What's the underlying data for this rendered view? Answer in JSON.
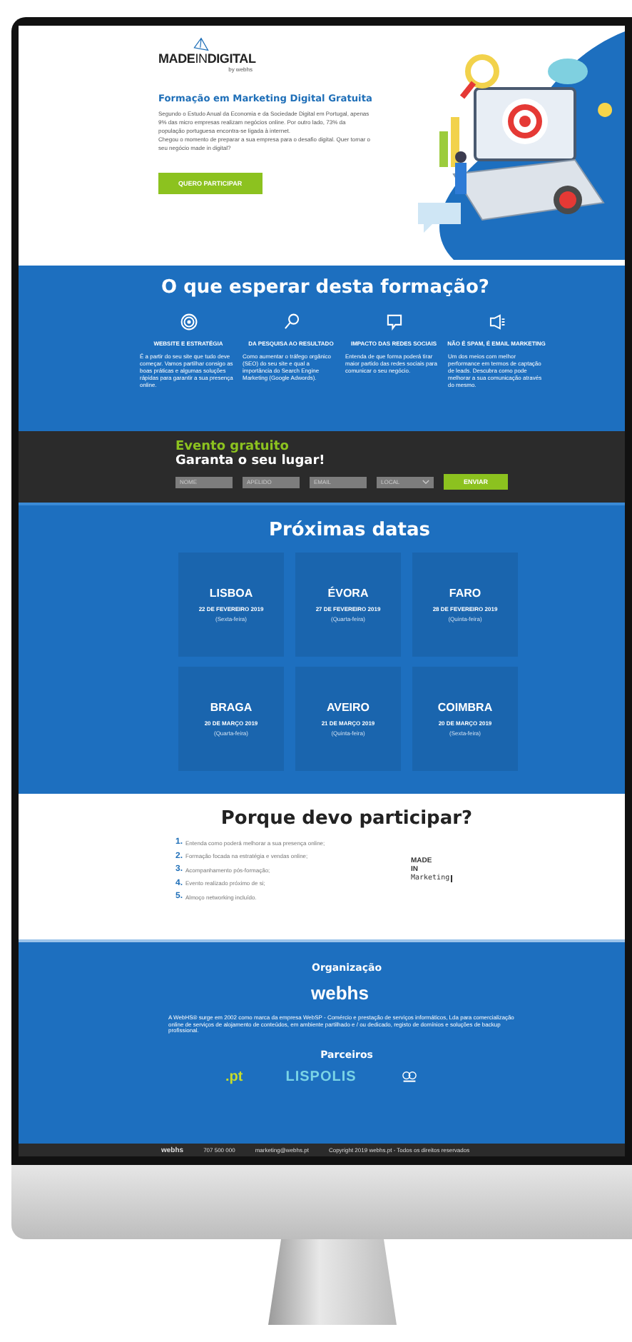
{
  "brand": {
    "made": "MADE",
    "in": "IN",
    "digital": "DIGITAL",
    "by": "by webhs"
  },
  "hero": {
    "title": "Formação em Marketing Digital Gratuita",
    "paragraphs": [
      "Segundo o Estudo Anual da Economia e da Sociedade Digital em Portugal, apenas 9% das micro empresas realizam negócios online. Por outro lado, 73% da população portuguesa encontra-se ligada à internet.",
      "Chegou o momento de preparar a sua empresa para o desafio digital. Quer tornar o seu negócio made in digital?"
    ],
    "button": "QUERO PARTICIPAR"
  },
  "features": {
    "title": "O que esperar desta formação?",
    "items": [
      {
        "title": "WEBSITE E ESTRATÉGIA",
        "text": "É a partir do seu site que tudo deve começar. Vamos partilhar consigo as boas práticas e algumas soluções rápidas para garantir a sua presença online."
      },
      {
        "title": "DA PESQUISA AO RESULTADO",
        "text": "Como aumentar o tráfego orgânico (SEO) do seu site e qual a importância do Search Engine Marketing (Google Adwords)."
      },
      {
        "title": "IMPACTO DAS REDES SOCIAIS",
        "text": "Entenda de que forma poderá tirar maior partido das redes sociais para comunicar o seu negócio."
      },
      {
        "title": "NÃO É SPAM, É EMAIL MARKETING",
        "text": "Um dos meios com melhor performance em termos de captação de leads. Descubra como pode melhorar a sua comunicação através do mesmo."
      }
    ]
  },
  "event": {
    "label": "Evento gratuito",
    "title": "Garanta o seu lugar!",
    "fields": [
      {
        "kind": "text",
        "placeholder": "NOME"
      },
      {
        "kind": "text",
        "placeholder": "APELIDO"
      },
      {
        "kind": "text",
        "placeholder": "EMAIL"
      },
      {
        "kind": "select",
        "placeholder": "LOCAL"
      }
    ],
    "button": "ENVIAR"
  },
  "dates": {
    "title": "Próximas datas",
    "cards": [
      {
        "city": "LISBOA",
        "date": "22 DE FEVEREIRO 2019",
        "weekday": "(Sexta-feira)"
      },
      {
        "city": "ÉVORA",
        "date": "27 DE FEVEREIRO 2019",
        "weekday": "(Quarta-feira)"
      },
      {
        "city": "FARO",
        "date": "28 DE FEVEREIRO 2019",
        "weekday": "(Quinta-feira)"
      },
      {
        "city": "BRAGA",
        "date": "20 DE MARÇO 2019",
        "weekday": "(Quarta-feira)"
      },
      {
        "city": "AVEIRO",
        "date": "21 DE MARÇO 2019",
        "weekday": "(Quinta-feira)"
      },
      {
        "city": "COIMBRA",
        "date": "20 DE MARÇO 2019",
        "weekday": "(Sexta-feira)"
      }
    ]
  },
  "why": {
    "title": "Porque devo participar?",
    "items": [
      {
        "number": "1.",
        "text": "Entenda como poderá melhorar a sua presença online;"
      },
      {
        "number": "2.",
        "text": "Formação focada na estratégia e vendas online;"
      },
      {
        "number": "3.",
        "text": "Acompanhamento pós-formação;"
      },
      {
        "number": "4.",
        "text": "Evento realizado próximo de si;"
      },
      {
        "number": "5.",
        "text": "Almoço networking incluído."
      }
    ],
    "logo": [
      "MADE",
      "IN",
      "Marketing"
    ]
  },
  "organization": {
    "title": "Organização",
    "logo": "webhs",
    "text": "A WebHS® surge em 2002 como marca da empresa WebSP - Comércio e prestação de serviços informáticos, Lda para comercialização online de serviços de alojamento de conteúdos, em ambiente partilhado e / ou dedicado, registo de domínios e soluções de backup profissional.",
    "partners_title": "Parceiros",
    "partners": [
      ".pt",
      "LISPOLIS"
    ]
  },
  "footer": {
    "logo": "webhs",
    "phone": "707 500 000",
    "email": "marketing@webhs.pt",
    "copyright": "Copyright 2019 webhs.pt - Todos os direitos reservados"
  }
}
